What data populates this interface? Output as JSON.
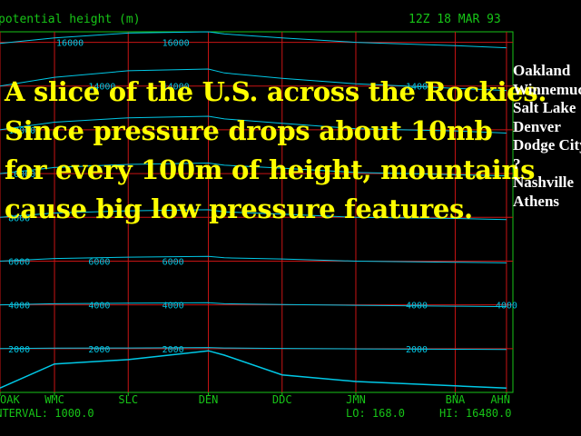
{
  "header": {
    "title": "potential height (m)",
    "timestamp": "12Z 18 MAR 93"
  },
  "overlay_lines": [
    "A slice of the U.S. across the Rockies.",
    "Since pressure drops about 10mb",
    "for every 100m of height, mountains",
    "cause big low pressure features."
  ],
  "station_list": [
    "Oakland",
    "Winnemucca",
    "Salt Lake",
    "Denver",
    "Dodge City",
    "?",
    "Nashville",
    "Athens"
  ],
  "footer": {
    "interval": "INTERVAL: 1000.0",
    "lo": "LO: 168.0",
    "hi": "HI: 16480.0"
  },
  "colors": {
    "background": "#000000",
    "axis": "#17c417",
    "grid": "#c81414",
    "contour": "#00c8e6",
    "overlay_text": "#ffff00",
    "station_text": "#ffffff"
  },
  "chart_data": {
    "type": "line",
    "title": "potential height (m)",
    "stations": [
      "OAK",
      "WMC",
      "SLC",
      "DEN",
      "DDC",
      "JMN",
      "BNA",
      "AHN"
    ],
    "station_x": [
      0,
      0.85,
      2,
      3.25,
      4.4,
      5.55,
      7.1,
      7.9
    ],
    "x_range": [
      0,
      8
    ],
    "y_range": [
      0,
      16480
    ],
    "y_gridlines": [
      2000,
      4000,
      6000,
      8000,
      10000,
      12000,
      14000,
      16000
    ],
    "contour_labels": [
      {
        "x": 0.85,
        "y": 16000,
        "text": "16000"
      },
      {
        "x": 2.5,
        "y": 16000,
        "text": "16000"
      },
      {
        "x": 1.35,
        "y": 14000,
        "text": "14000"
      },
      {
        "x": 2.5,
        "y": 14000,
        "text": "14000"
      },
      {
        "x": 6.3,
        "y": 14000,
        "text": "14000"
      },
      {
        "x": 0.1,
        "y": 12000,
        "text": "12000"
      },
      {
        "x": 0.1,
        "y": 10000,
        "text": "10000"
      },
      {
        "x": 0.1,
        "y": 8000,
        "text": "8000"
      },
      {
        "x": 0.1,
        "y": 6000,
        "text": "6000"
      },
      {
        "x": 1.35,
        "y": 6000,
        "text": "6000"
      },
      {
        "x": 2.5,
        "y": 6000,
        "text": "6000"
      },
      {
        "x": 0.1,
        "y": 4000,
        "text": "4000"
      },
      {
        "x": 1.35,
        "y": 4000,
        "text": "4000"
      },
      {
        "x": 2.5,
        "y": 4000,
        "text": "4000"
      },
      {
        "x": 6.3,
        "y": 4000,
        "text": "4000"
      },
      {
        "x": 7.7,
        "y": 4000,
        "text": "4000"
      },
      {
        "x": 0.1,
        "y": 2000,
        "text": "2000"
      },
      {
        "x": 1.35,
        "y": 2000,
        "text": "2000"
      },
      {
        "x": 2.5,
        "y": 2000,
        "text": "2000"
      },
      {
        "x": 6.3,
        "y": 2000,
        "text": "2000"
      }
    ],
    "terrain": {
      "x": [
        0,
        0.85,
        2,
        3.25,
        3.5,
        4.4,
        5.55,
        7.1,
        7.9
      ],
      "y": [
        200,
        1300,
        1500,
        1900,
        1700,
        800,
        500,
        300,
        200
      ]
    },
    "contours": [
      {
        "level": 2000,
        "y": [
          2000,
          2020,
          2030,
          2050,
          2030,
          2010,
          1990,
          1970,
          1960
        ]
      },
      {
        "level": 4000,
        "y": [
          4000,
          4050,
          4080,
          4100,
          4050,
          4020,
          3980,
          3940,
          3920
        ]
      },
      {
        "level": 6000,
        "y": [
          6000,
          6120,
          6180,
          6220,
          6150,
          6100,
          6000,
          5950,
          5920
        ]
      },
      {
        "level": 8000,
        "y": [
          8000,
          8200,
          8300,
          8350,
          8250,
          8150,
          8000,
          7950,
          7900
        ]
      },
      {
        "level": 10000,
        "y": [
          10000,
          10280,
          10420,
          10480,
          10380,
          10250,
          10050,
          9950,
          9900
        ]
      },
      {
        "level": 12000,
        "y": [
          12000,
          12350,
          12550,
          12620,
          12500,
          12300,
          12050,
          11950,
          11850
        ]
      },
      {
        "level": 14000,
        "y": [
          14000,
          14400,
          14700,
          14780,
          14600,
          14350,
          14100,
          13900,
          13800
        ]
      },
      {
        "level": 16000,
        "y": [
          15950,
          16200,
          16420,
          16480,
          16380,
          16200,
          16000,
          15850,
          15750
        ]
      }
    ]
  }
}
